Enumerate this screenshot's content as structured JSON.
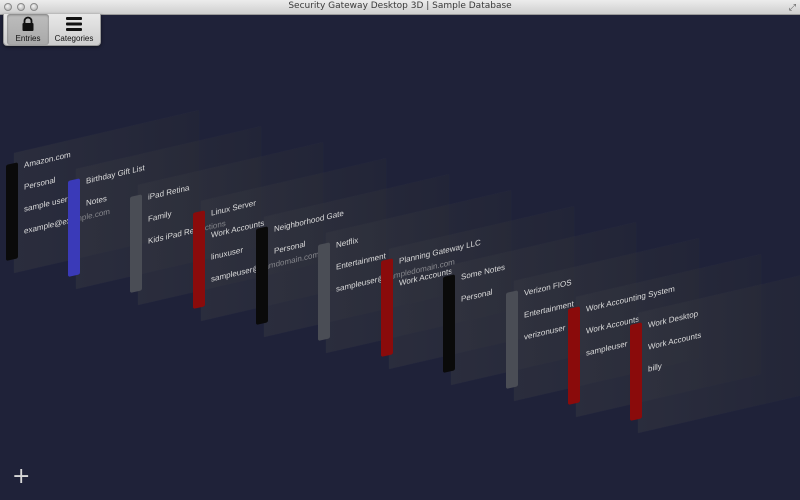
{
  "window": {
    "title": "Security Gateway Desktop 3D | Sample Database"
  },
  "toolbar": {
    "entries_label": "Entries",
    "categories_label": "Categories"
  },
  "colors": {
    "background": "#1f2239",
    "black": "#0a0a0a",
    "blue": "#3a3ab8",
    "gray": "#4a4d55",
    "red": "#8a0b0b"
  },
  "cards": [
    {
      "color": "black",
      "lines": [
        "Amazon.com",
        "Personal",
        "sample user",
        "example@example.com"
      ]
    },
    {
      "color": "blue",
      "lines": [
        "Birthday Gift List",
        "Notes"
      ]
    },
    {
      "color": "gray",
      "lines": [
        "iPad Retina",
        "Family",
        "Kids iPad Restrictions"
      ]
    },
    {
      "color": "red",
      "lines": [
        "Linux Server",
        "Work Accounts",
        "linuxuser",
        "sampleuser@samdomain.com"
      ]
    },
    {
      "color": "black",
      "lines": [
        "Neighborhood Gate",
        "Personal"
      ]
    },
    {
      "color": "gray",
      "lines": [
        "Netflix",
        "Entertainment",
        "sampleuser@sampledomain.com"
      ]
    },
    {
      "color": "red",
      "lines": [
        "Planning Gateway LLC",
        "Work Accounts"
      ]
    },
    {
      "color": "black",
      "lines": [
        "Some Notes",
        "Personal"
      ]
    },
    {
      "color": "gray",
      "lines": [
        "Verizon FIOS",
        "Entertainment",
        "verizonuser"
      ]
    },
    {
      "color": "red",
      "lines": [
        "Work Accounting System",
        "Work Accounts",
        "sampleuser"
      ]
    },
    {
      "color": "red",
      "lines": [
        "Work Desktop",
        "Work Accounts",
        "billy"
      ]
    }
  ],
  "add_label": "+"
}
